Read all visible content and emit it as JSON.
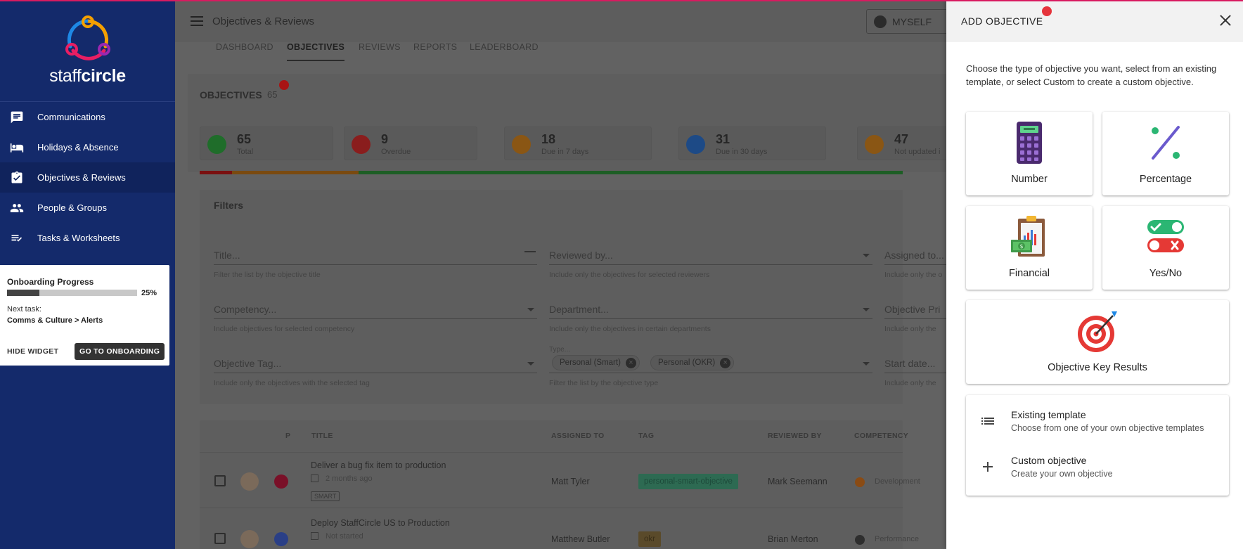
{
  "app": {
    "brand_prefix": "staff",
    "brand_suffix": "circle",
    "page_title": "Objectives & Reviews",
    "myself_label": "MYSELF"
  },
  "sidebar": {
    "items": [
      {
        "label": "Communications",
        "icon": "chat-icon"
      },
      {
        "label": "Holidays & Absence",
        "icon": "bed-icon"
      },
      {
        "label": "Objectives & Reviews",
        "icon": "clipboard-check-icon",
        "active": true
      },
      {
        "label": "People & Groups",
        "icon": "people-icon"
      },
      {
        "label": "Tasks & Worksheets",
        "icon": "checklist-icon"
      }
    ]
  },
  "onboarding": {
    "title": "Onboarding Progress",
    "progress": 0.25,
    "percent_label": "25%",
    "next_label": "Next task:",
    "next_task": "Comms & Culture > Alerts",
    "hide_label": "HIDE WIDGET",
    "go_label": "GO TO ONBOARDING"
  },
  "tabs": [
    "DASHBOARD",
    "OBJECTIVES",
    "REVIEWS",
    "REPORTS",
    "LEADERBOARD"
  ],
  "objectives": {
    "title": "OBJECTIVES",
    "count": "65",
    "stats": [
      {
        "num": "65",
        "label": "Total",
        "color": "#1f6d2a"
      },
      {
        "num": "9",
        "label": "Overdue",
        "color": "#8a1d1d"
      },
      {
        "num": "18",
        "label": "Due in 7 days",
        "color": "#8a5614"
      },
      {
        "num": "31",
        "label": "Due in 30 days",
        "color": "#1d4a86"
      },
      {
        "num": "47",
        "label": "Not updated i",
        "color": "#8a5614"
      }
    ]
  },
  "filters": {
    "title": "Filters",
    "title_field": {
      "placeholder": "Title...",
      "hint": "Filter the list by the objective title"
    },
    "reviewed_by": {
      "placeholder": "Reviewed by...",
      "hint": "Include only the objectives for selected reviewers"
    },
    "assigned_to": {
      "placeholder": "Assigned to...",
      "hint": "Include only the o"
    },
    "competency": {
      "placeholder": "Competency...",
      "hint": "Include objectives for selected competency"
    },
    "department": {
      "placeholder": "Department...",
      "hint": "Include only the objectives in certain departments"
    },
    "objective_priority": {
      "placeholder": "Objective Pri",
      "hint": "Include only the"
    },
    "objective_tag": {
      "placeholder": "Objective Tag...",
      "hint": "Include only the objectives with the selected tag"
    },
    "type": {
      "label": "Type...",
      "chips": [
        "Personal (Smart)",
        "Personal (OKR)"
      ],
      "hint": "Filter the list by the objective type"
    },
    "start_date": {
      "placeholder": "Start date...",
      "hint": "Include only the"
    }
  },
  "table": {
    "headers": [
      "P",
      "TITLE",
      "ASSIGNED TO",
      "TAG",
      "REVIEWED BY",
      "COMPETENCY"
    ],
    "rows": [
      {
        "title": "Deliver a bug fix item to production",
        "due": "2 months ago",
        "kind": "SMART",
        "assigned": "Matt Tyler",
        "tag": "personal-smart-objective",
        "tag_color": "#2d6a52",
        "reviewer": "Mark Seemann",
        "competency": "Development",
        "prio_color": "#7a1028",
        "comp_color": "#8a4b14"
      },
      {
        "title": "Deploy StaffCircle US to Production",
        "due": "Not started",
        "kind": "",
        "assigned": "Matthew Butler",
        "tag": "okr",
        "tag_color": "#5a4a2a",
        "reviewer": "Brian Merton",
        "competency": "Performance",
        "prio_color": "#2a3f86",
        "comp_color": "#2e2e2e"
      }
    ]
  },
  "drawer": {
    "title": "ADD OBJECTIVE",
    "intro": "Choose the type of objective you want, select from an existing template, or select Custom to create a custom objective.",
    "tiles": [
      {
        "label": "Number",
        "icon": "calculator-icon"
      },
      {
        "label": "Percentage",
        "icon": "percent-icon"
      },
      {
        "label": "Financial",
        "icon": "financial-clipboard-icon"
      },
      {
        "label": "Yes/No",
        "icon": "toggle-icon"
      },
      {
        "label": "Objective Key Results",
        "icon": "target-icon"
      }
    ],
    "existing": {
      "title": "Existing template",
      "sub": "Choose from one of your own objective templates"
    },
    "custom": {
      "title": "Custom objective",
      "sub": "Create your own objective"
    }
  }
}
